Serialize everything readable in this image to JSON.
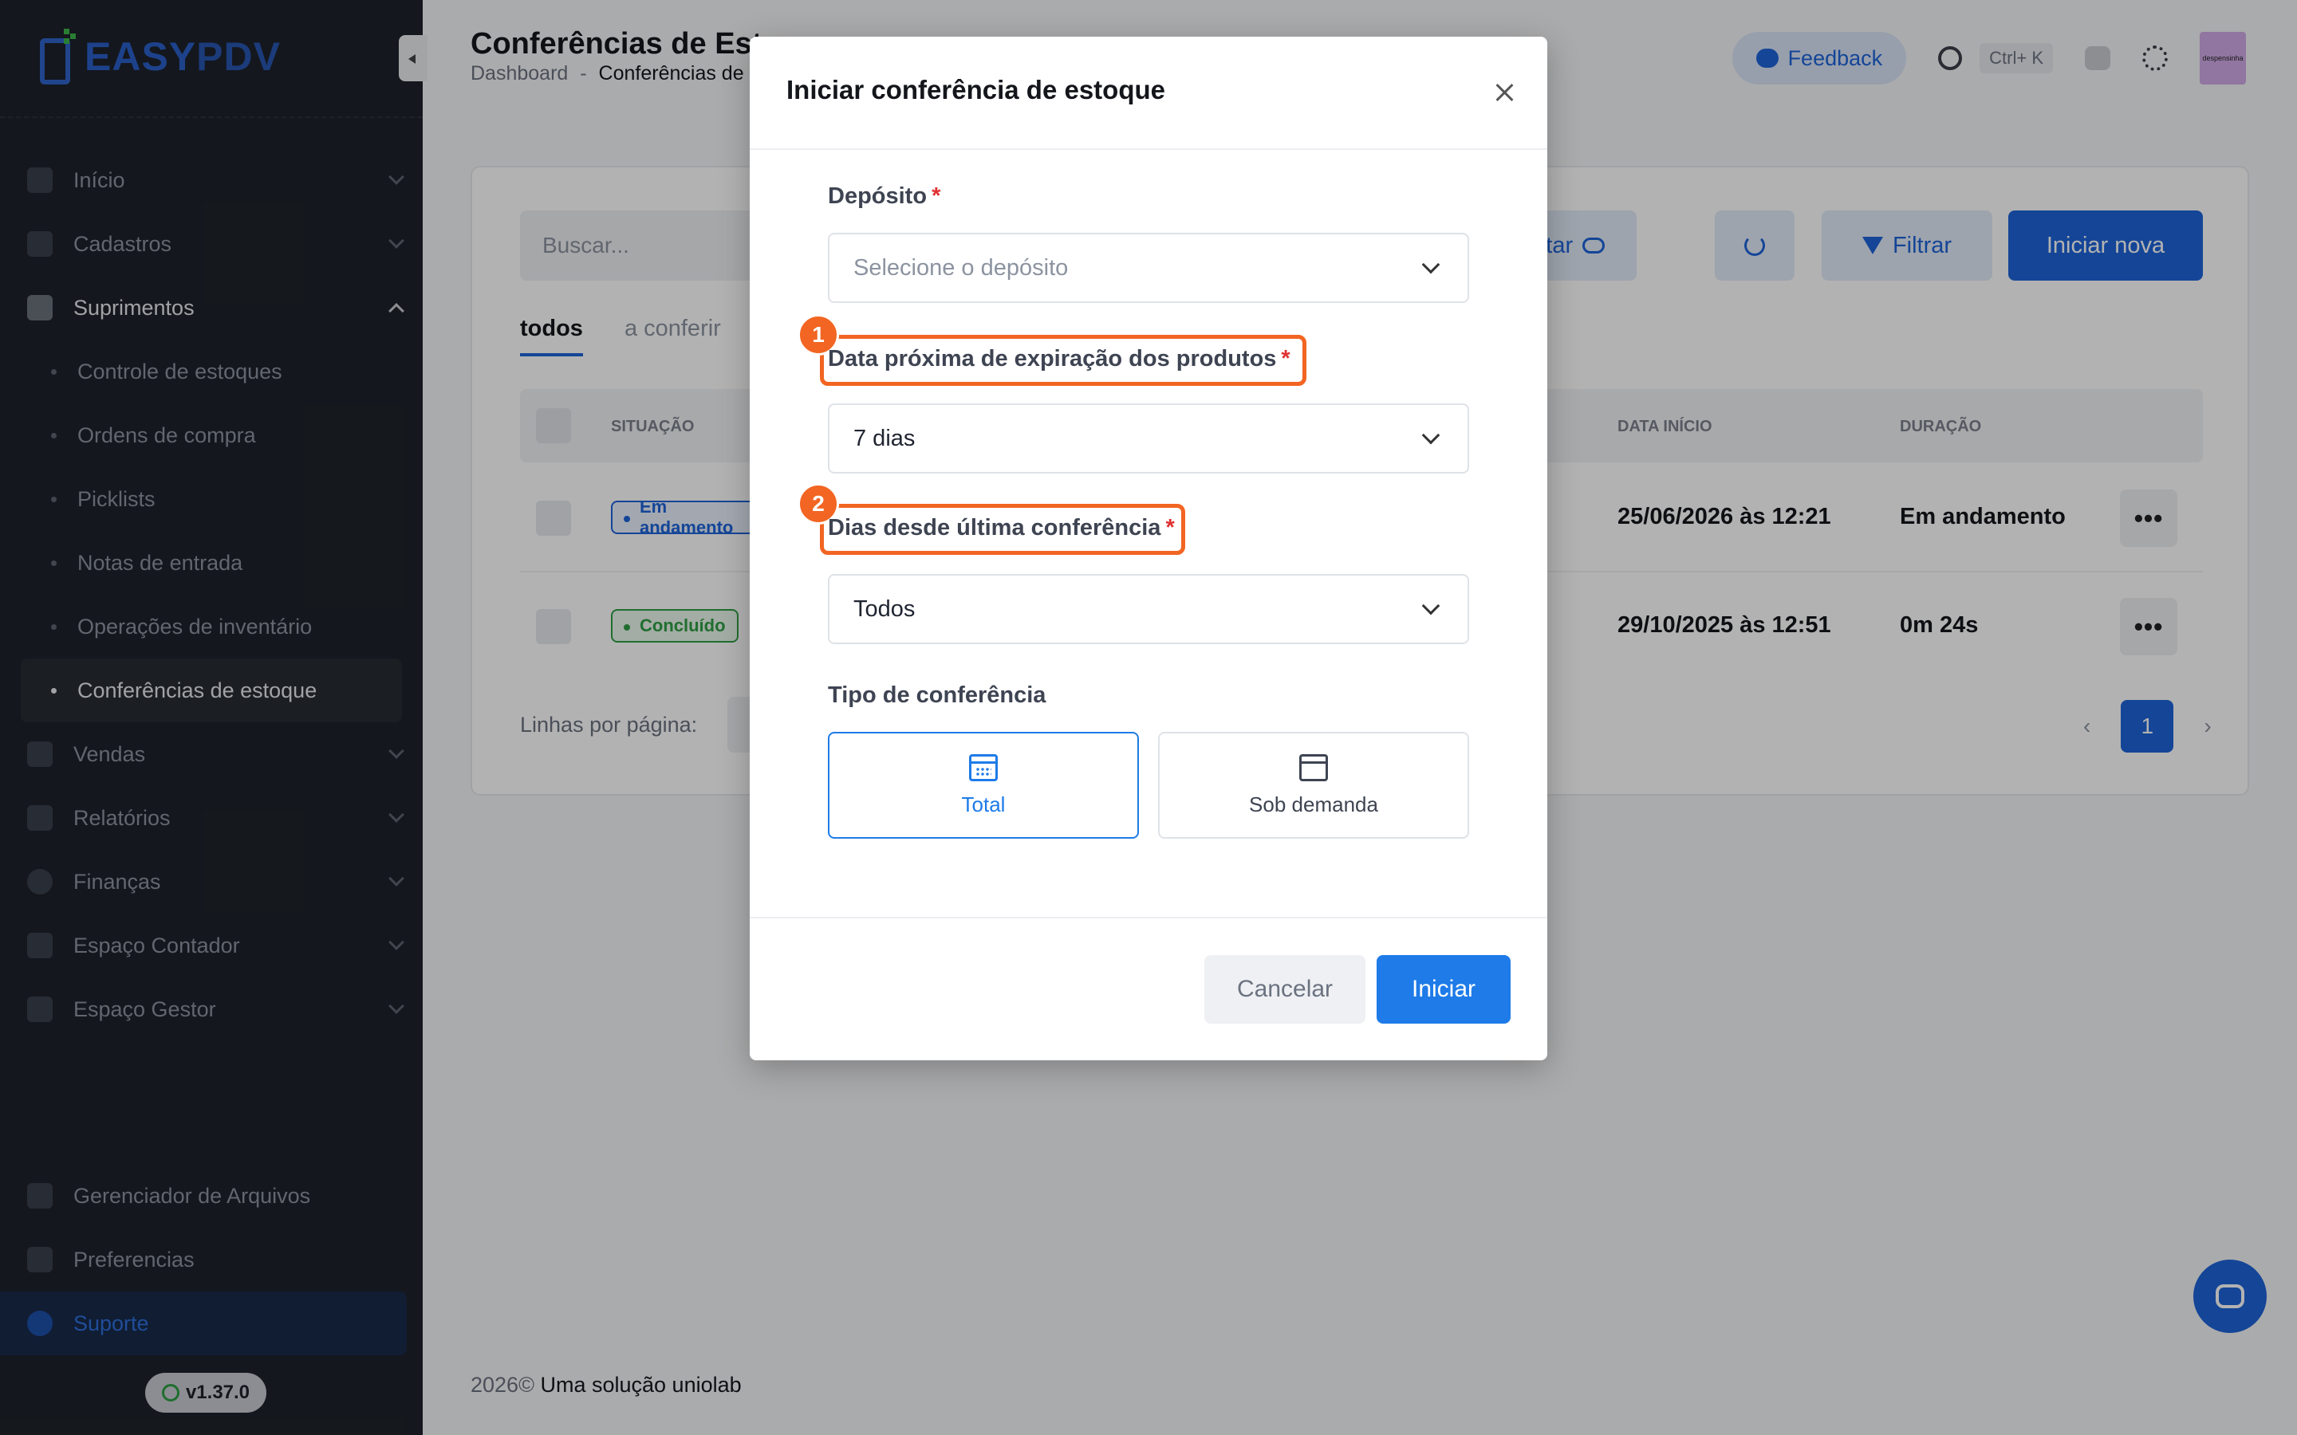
{
  "brand": {
    "logo_a": "EASY",
    "logo_b": "PDV"
  },
  "sidebar": {
    "items": [
      {
        "label": "Início",
        "icon": "grid-icon"
      },
      {
        "label": "Cadastros",
        "icon": "id-card-icon"
      },
      {
        "label": "Suprimentos",
        "icon": "box-icon"
      }
    ],
    "sub_items": [
      {
        "label": "Controle de estoques"
      },
      {
        "label": "Ordens de compra"
      },
      {
        "label": "Picklists"
      },
      {
        "label": "Notas de entrada"
      },
      {
        "label": "Operações de inventário"
      },
      {
        "label": "Conferências de estoque"
      }
    ],
    "items_after": [
      {
        "label": "Vendas"
      },
      {
        "label": "Relatórios"
      },
      {
        "label": "Finanças"
      },
      {
        "label": "Espaço Contador"
      },
      {
        "label": "Espaço Gestor"
      }
    ],
    "bottom": [
      {
        "label": "Gerenciador de Arquivos"
      },
      {
        "label": "Preferencias"
      },
      {
        "label": "Suporte"
      }
    ],
    "version": "v1.37.0"
  },
  "header": {
    "title": "Conferências de Esto",
    "breadcrumb_root": "Dashboard",
    "breadcrumb_sep": "-",
    "breadcrumb_current": "Conferências de",
    "feedback": "Feedback",
    "shortcut": "Ctrl+ K",
    "avatar_text": "despensinha"
  },
  "toolbar": {
    "search_placeholder": "Buscar...",
    "export": "xportar",
    "filter": "Filtrar",
    "new": "Iniciar nova"
  },
  "tabs": [
    "todos",
    "a conferir"
  ],
  "table": {
    "columns": {
      "status": "SITUAÇÃO",
      "start": "DATA INÍCIO",
      "duration": "DURAÇÃO"
    },
    "rows": [
      {
        "status": "Em andamento",
        "start": "25/06/2026 às 12:21",
        "duration": "Em andamento"
      },
      {
        "status": "Concluído",
        "start": "29/10/2025 às 12:51",
        "duration": "0m 24s"
      }
    ],
    "rows_per_page": "Linhas por página:",
    "current_page": "1"
  },
  "footer": {
    "year": "2026©",
    "text": "Uma solução uniolab"
  },
  "modal": {
    "title": "Iniciar conferência de estoque",
    "deposit_label": "Depósito",
    "deposit_placeholder": "Selecione o depósito",
    "expiry_label": "Data próxima de expiração dos produtos",
    "expiry_value": "7 dias",
    "since_label": "Dias desde última conferência",
    "since_value": "Todos",
    "type_label": "Tipo de conferência",
    "type_total": "Total",
    "type_demand": "Sob demanda",
    "required_mark": "*",
    "cancel": "Cancelar",
    "start": "Iniciar",
    "step_1": "1",
    "step_2": "2"
  },
  "colors": {
    "accent": "#1e63d9",
    "highlight": "#f26522",
    "sidebar_bg": "#1e222a"
  }
}
